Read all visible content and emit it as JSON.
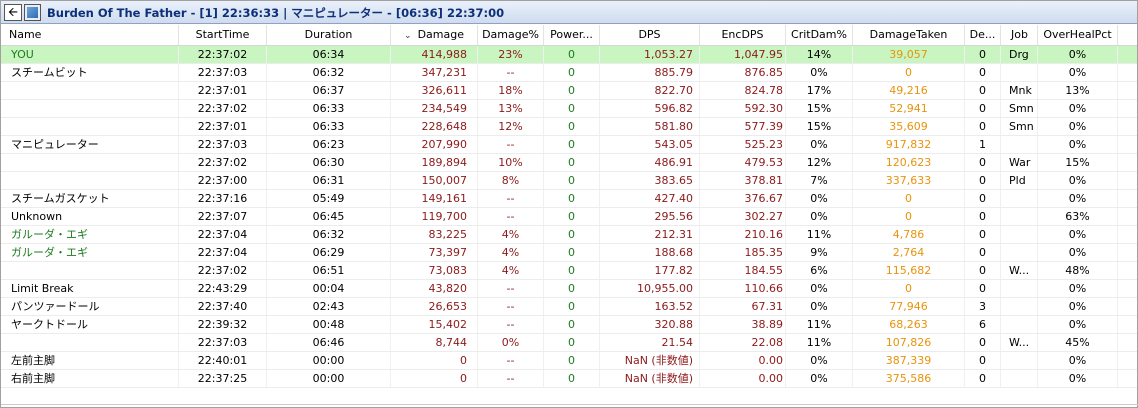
{
  "window": {
    "back_icon": "left-arrow-icon",
    "title": "Burden Of The Father - [1] 22:36:33 | マニピュレーター - [06:36] 22:37:00"
  },
  "columns": {
    "name": "Name",
    "start": "StartTime",
    "duration": "Duration",
    "sort_indicator": "⌄",
    "damage": "Damage",
    "damage_pct": "Damage%",
    "power": "Power...",
    "dps": "DPS",
    "encdps": "EncDPS",
    "critdam": "CritDam%",
    "taken": "DamageTaken",
    "deaths": "De...",
    "job": "Job",
    "overheal": "OverHealPct"
  },
  "colors": {
    "you_row": "#c9f5c1",
    "damage_text": "#8b1a1a",
    "power_text": "#1e7b1e",
    "taken_text": "#e8930c",
    "npc_name": "#1e7b1e"
  },
  "rows": [
    {
      "name": "YOU",
      "start": "22:37:02",
      "duration": "06:34",
      "damage": "414,988",
      "damage_pct": "23%",
      "power": "0",
      "dps": "1,053.27",
      "encdps": "1,047.95",
      "critdam": "14%",
      "taken": "39,057",
      "deaths": "0",
      "job": "Drg",
      "overheal": "0%"
    },
    {
      "name": "スチームビット",
      "start": "22:37:03",
      "duration": "06:32",
      "damage": "347,231",
      "damage_pct": "--",
      "power": "0",
      "dps": "885.79",
      "encdps": "876.85",
      "critdam": "0%",
      "taken": "0",
      "deaths": "0",
      "job": "",
      "overheal": "0%"
    },
    {
      "name": "",
      "start": "22:37:01",
      "duration": "06:37",
      "damage": "326,611",
      "damage_pct": "18%",
      "power": "0",
      "dps": "822.70",
      "encdps": "824.78",
      "critdam": "17%",
      "taken": "49,216",
      "deaths": "0",
      "job": "Mnk",
      "overheal": "13%"
    },
    {
      "name": "",
      "start": "22:37:02",
      "duration": "06:33",
      "damage": "234,549",
      "damage_pct": "13%",
      "power": "0",
      "dps": "596.82",
      "encdps": "592.30",
      "critdam": "15%",
      "taken": "52,941",
      "deaths": "0",
      "job": "Smn",
      "overheal": "0%"
    },
    {
      "name": "",
      "start": "22:37:01",
      "duration": "06:33",
      "damage": "228,648",
      "damage_pct": "12%",
      "power": "0",
      "dps": "581.80",
      "encdps": "577.39",
      "critdam": "15%",
      "taken": "35,609",
      "deaths": "0",
      "job": "Smn",
      "overheal": "0%"
    },
    {
      "name": "マニピュレーター",
      "start": "22:37:03",
      "duration": "06:23",
      "damage": "207,990",
      "damage_pct": "--",
      "power": "0",
      "dps": "543.05",
      "encdps": "525.23",
      "critdam": "0%",
      "taken": "917,832",
      "deaths": "1",
      "job": "",
      "overheal": "0%"
    },
    {
      "name": "",
      "start": "22:37:02",
      "duration": "06:30",
      "damage": "189,894",
      "damage_pct": "10%",
      "power": "0",
      "dps": "486.91",
      "encdps": "479.53",
      "critdam": "12%",
      "taken": "120,623",
      "deaths": "0",
      "job": "War",
      "overheal": "15%"
    },
    {
      "name": "",
      "start": "22:37:00",
      "duration": "06:31",
      "damage": "150,007",
      "damage_pct": "8%",
      "power": "0",
      "dps": "383.65",
      "encdps": "378.81",
      "critdam": "7%",
      "taken": "337,633",
      "deaths": "0",
      "job": "Pld",
      "overheal": "0%"
    },
    {
      "name": "スチームガスケット",
      "start": "22:37:16",
      "duration": "05:49",
      "damage": "149,161",
      "damage_pct": "--",
      "power": "0",
      "dps": "427.40",
      "encdps": "376.67",
      "critdam": "0%",
      "taken": "0",
      "deaths": "0",
      "job": "",
      "overheal": "0%"
    },
    {
      "name": "Unknown",
      "start": "22:37:07",
      "duration": "06:45",
      "damage": "119,700",
      "damage_pct": "--",
      "power": "0",
      "dps": "295.56",
      "encdps": "302.27",
      "critdam": "0%",
      "taken": "0",
      "deaths": "0",
      "job": "",
      "overheal": "63%"
    },
    {
      "name": "ガルーダ・エギ",
      "start": "22:37:04",
      "duration": "06:32",
      "damage": "83,225",
      "damage_pct": "4%",
      "power": "0",
      "dps": "212.31",
      "encdps": "210.16",
      "critdam": "11%",
      "taken": "4,786",
      "deaths": "0",
      "job": "",
      "overheal": "0%",
      "green": true
    },
    {
      "name": "ガルーダ・エギ",
      "start": "22:37:04",
      "duration": "06:29",
      "damage": "73,397",
      "damage_pct": "4%",
      "power": "0",
      "dps": "188.68",
      "encdps": "185.35",
      "critdam": "9%",
      "taken": "2,764",
      "deaths": "0",
      "job": "",
      "overheal": "0%",
      "green": true
    },
    {
      "name": "",
      "start": "22:37:02",
      "duration": "06:51",
      "damage": "73,083",
      "damage_pct": "4%",
      "power": "0",
      "dps": "177.82",
      "encdps": "184.55",
      "critdam": "6%",
      "taken": "115,682",
      "deaths": "0",
      "job": "W...",
      "overheal": "48%"
    },
    {
      "name": "Limit Break",
      "start": "22:43:29",
      "duration": "00:04",
      "damage": "43,820",
      "damage_pct": "--",
      "power": "0",
      "dps": "10,955.00",
      "encdps": "110.66",
      "critdam": "0%",
      "taken": "0",
      "deaths": "0",
      "job": "",
      "overheal": "0%"
    },
    {
      "name": "パンツァードール",
      "start": "22:37:40",
      "duration": "02:43",
      "damage": "26,653",
      "damage_pct": "--",
      "power": "0",
      "dps": "163.52",
      "encdps": "67.31",
      "critdam": "0%",
      "taken": "77,946",
      "deaths": "3",
      "job": "",
      "overheal": "0%"
    },
    {
      "name": "ヤークトドール",
      "start": "22:39:32",
      "duration": "00:48",
      "damage": "15,402",
      "damage_pct": "--",
      "power": "0",
      "dps": "320.88",
      "encdps": "38.89",
      "critdam": "11%",
      "taken": "68,263",
      "deaths": "6",
      "job": "",
      "overheal": "0%"
    },
    {
      "name": "",
      "start": "22:37:03",
      "duration": "06:46",
      "damage": "8,744",
      "damage_pct": "0%",
      "power": "0",
      "dps": "21.54",
      "encdps": "22.08",
      "critdam": "11%",
      "taken": "107,826",
      "deaths": "0",
      "job": "W...",
      "overheal": "45%"
    },
    {
      "name": "左前主脚",
      "start": "22:40:01",
      "duration": "00:00",
      "damage": "0",
      "damage_pct": "--",
      "power": "0",
      "dps": "NaN (非数値)",
      "encdps": "0.00",
      "critdam": "0%",
      "taken": "387,339",
      "deaths": "0",
      "job": "",
      "overheal": "0%"
    },
    {
      "name": "右前主脚",
      "start": "22:37:25",
      "duration": "00:00",
      "damage": "0",
      "damage_pct": "--",
      "power": "0",
      "dps": "NaN (非数値)",
      "encdps": "0.00",
      "critdam": "0%",
      "taken": "375,586",
      "deaths": "0",
      "job": "",
      "overheal": "0%"
    }
  ]
}
